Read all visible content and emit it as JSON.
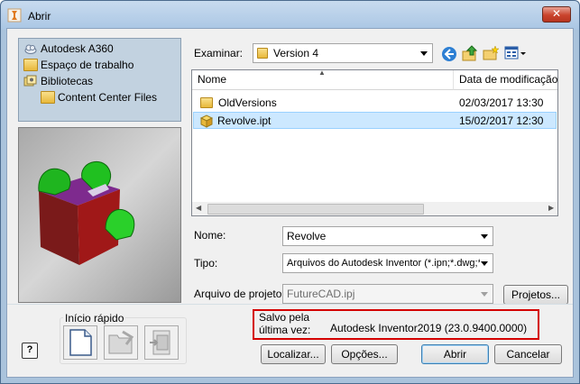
{
  "window": {
    "title": "Abrir",
    "close_label": "✕"
  },
  "places": [
    {
      "label": "Autodesk A360",
      "icon": "cloud-icon"
    },
    {
      "label": "Espaço de trabalho",
      "icon": "folder-icon"
    },
    {
      "label": "Bibliotecas",
      "icon": "library-icon"
    },
    {
      "label": "Content Center Files",
      "icon": "folder-icon"
    }
  ],
  "lookin": {
    "label": "Examinar:",
    "value": "Version 4"
  },
  "filelist": {
    "columns": [
      "Nome",
      "Data de modificação"
    ],
    "rows": [
      {
        "name": "OldVersions",
        "date": "02/03/2017 13:30",
        "icon": "folder-icon",
        "selected": false
      },
      {
        "name": "Revolve.ipt",
        "date": "15/02/2017 12:30",
        "icon": "part-icon",
        "selected": true
      }
    ]
  },
  "fields": {
    "name_label": "Nome:",
    "name_value": "Revolve",
    "type_label": "Tipo:",
    "type_value": "Arquivos do Autodesk Inventor (*.ipn;*.dwg;*",
    "project_label": "Arquivo de projeto:",
    "project_value": "FutureCAD.ipj",
    "projects_button": "Projetos..."
  },
  "quick_start": {
    "label": "Início rápido"
  },
  "saved": {
    "label_line1": "Salvo pela",
    "label_line2": "última vez:",
    "value": "Autodesk Inventor2019 (23.0.9400.0000)"
  },
  "buttons": {
    "find": "Localizar...",
    "options": "Opções...",
    "open": "Abrir",
    "cancel": "Cancelar"
  },
  "help": {
    "label": "?"
  },
  "colors": {
    "accent_title": "#aac6e4",
    "selection": "#cce8ff",
    "highlight_box": "#d40000"
  }
}
